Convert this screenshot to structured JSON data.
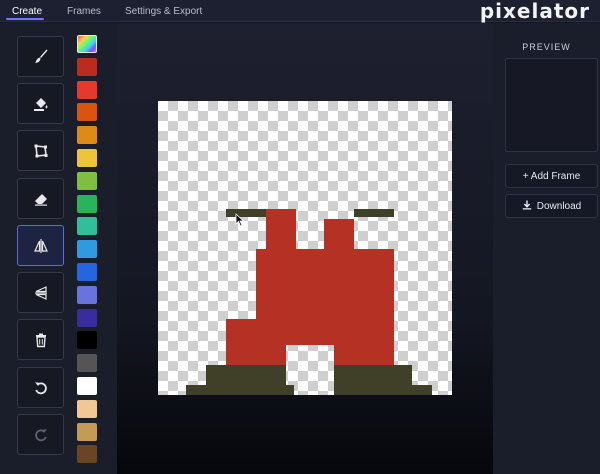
{
  "nav": {
    "tabs": [
      {
        "label": "Create",
        "active": true
      },
      {
        "label": "Frames",
        "active": false
      },
      {
        "label": "Settings & Export",
        "active": false
      }
    ],
    "brand": "pixelator"
  },
  "tools": [
    {
      "name": "brush",
      "icon": "brush-icon",
      "active": false
    },
    {
      "name": "fill",
      "icon": "paint-bucket-icon",
      "active": false
    },
    {
      "name": "select",
      "icon": "crop-icon",
      "active": false
    },
    {
      "name": "eraser",
      "icon": "eraser-icon",
      "active": false
    },
    {
      "name": "mirror",
      "icon": "mirror-icon",
      "active": true
    },
    {
      "name": "flip",
      "icon": "flip-icon",
      "active": false
    },
    {
      "name": "delete",
      "icon": "trash-icon",
      "active": false
    },
    {
      "name": "undo",
      "icon": "undo-icon",
      "active": false
    },
    {
      "name": "redo",
      "icon": "redo-icon",
      "active": false,
      "disabled": true
    }
  ],
  "palette": [
    "rainbow",
    "#bc2a22",
    "#e6392e",
    "#d9540f",
    "#dd8a16",
    "#f0c43a",
    "#7fbf3f",
    "#29b35a",
    "#2fbf9b",
    "#2f9ae0",
    "#2565e0",
    "#6a72dd",
    "#3a2b9e",
    "#000000",
    "#555555",
    "#ffffff",
    "#f3c695",
    "#c59a55",
    "#6b4424"
  ],
  "colors": {
    "accent": "#5c68e6",
    "red": "#b53123",
    "olive": "#3f4027"
  },
  "preview": {
    "title": "PREVIEW"
  },
  "actions": {
    "add_frame": "+ Add Frame",
    "download": "Download"
  }
}
